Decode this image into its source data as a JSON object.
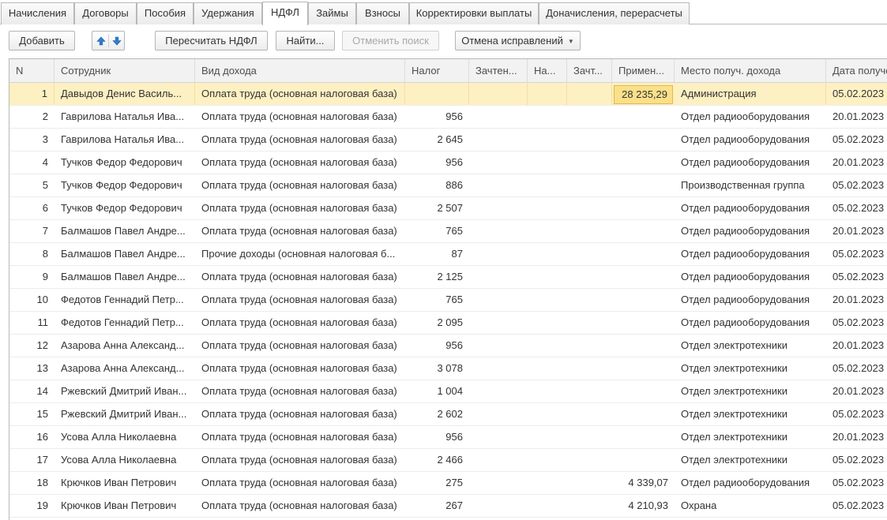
{
  "tabs": [
    {
      "label": "Начисления"
    },
    {
      "label": "Договоры"
    },
    {
      "label": "Пособия"
    },
    {
      "label": "Удержания"
    },
    {
      "label": "НДФЛ",
      "active": true
    },
    {
      "label": "Займы"
    },
    {
      "label": "Взносы"
    },
    {
      "label": "Корректировки выплаты"
    },
    {
      "label": "Доначисления, перерасчеты"
    }
  ],
  "toolbar": {
    "add_label": "Добавить",
    "move_up_icon": "arrow-up-icon",
    "move_down_icon": "arrow-down-icon",
    "recalc_label": "Пересчитать НДФЛ",
    "find_label": "Найти...",
    "cancel_search_label": "Отменить поиск",
    "undo_corrections_label": "Отмена исправлений"
  },
  "colors": {
    "selected_row": "#fdf0c2",
    "active_cell": "#fbe08a",
    "header_bg": "#f2f2f2",
    "arrow_blue": "#2f7fd0"
  },
  "grid": {
    "columns": [
      {
        "key": "n",
        "label": "N"
      },
      {
        "key": "employee",
        "label": "Сотрудник"
      },
      {
        "key": "income_type",
        "label": "Вид дохода"
      },
      {
        "key": "tax",
        "label": "Налог"
      },
      {
        "key": "credited1",
        "label": "Зачтен..."
      },
      {
        "key": "na",
        "label": "На..."
      },
      {
        "key": "credited2",
        "label": "Зачт..."
      },
      {
        "key": "applied",
        "label": "Примен..."
      },
      {
        "key": "place",
        "label": "Место получ. дохода"
      },
      {
        "key": "date",
        "label": "Дата получе"
      }
    ],
    "rows": [
      {
        "n": "1",
        "employee": "Давыдов Денис Василь...",
        "income_type": "Оплата труда (основная налоговая база)",
        "tax": "",
        "credited1": "",
        "na": "",
        "credited2": "",
        "applied": "28 235,29",
        "place": "Администрация",
        "date": "05.02.2023"
      },
      {
        "n": "2",
        "employee": "Гаврилова Наталья Ива...",
        "income_type": "Оплата труда (основная налоговая база)",
        "tax": "956",
        "credited1": "",
        "na": "",
        "credited2": "",
        "applied": "",
        "place": "Отдел радиооборудования",
        "date": "20.01.2023"
      },
      {
        "n": "3",
        "employee": "Гаврилова Наталья Ива...",
        "income_type": "Оплата труда (основная налоговая база)",
        "tax": "2 645",
        "credited1": "",
        "na": "",
        "credited2": "",
        "applied": "",
        "place": "Отдел радиооборудования",
        "date": "05.02.2023"
      },
      {
        "n": "4",
        "employee": "Тучков Федор Федорович",
        "income_type": "Оплата труда (основная налоговая база)",
        "tax": "956",
        "credited1": "",
        "na": "",
        "credited2": "",
        "applied": "",
        "place": "Отдел радиооборудования",
        "date": "20.01.2023"
      },
      {
        "n": "5",
        "employee": "Тучков Федор Федорович",
        "income_type": "Оплата труда (основная налоговая база)",
        "tax": "886",
        "credited1": "",
        "na": "",
        "credited2": "",
        "applied": "",
        "place": "Производственная группа",
        "date": "05.02.2023"
      },
      {
        "n": "6",
        "employee": "Тучков Федор Федорович",
        "income_type": "Оплата труда (основная налоговая база)",
        "tax": "2 507",
        "credited1": "",
        "na": "",
        "credited2": "",
        "applied": "",
        "place": "Отдел радиооборудования",
        "date": "05.02.2023"
      },
      {
        "n": "7",
        "employee": "Балмашов Павел Андре...",
        "income_type": "Оплата труда (основная налоговая база)",
        "tax": "765",
        "credited1": "",
        "na": "",
        "credited2": "",
        "applied": "",
        "place": "Отдел радиооборудования",
        "date": "20.01.2023"
      },
      {
        "n": "8",
        "employee": "Балмашов Павел Андре...",
        "income_type": "Прочие доходы (основная налоговая б...",
        "tax": "87",
        "credited1": "",
        "na": "",
        "credited2": "",
        "applied": "",
        "place": "Отдел радиооборудования",
        "date": "05.02.2023"
      },
      {
        "n": "9",
        "employee": "Балмашов Павел Андре...",
        "income_type": "Оплата труда (основная налоговая база)",
        "tax": "2 125",
        "credited1": "",
        "na": "",
        "credited2": "",
        "applied": "",
        "place": "Отдел радиооборудования",
        "date": "05.02.2023"
      },
      {
        "n": "10",
        "employee": "Федотов Геннадий Петр...",
        "income_type": "Оплата труда (основная налоговая база)",
        "tax": "765",
        "credited1": "",
        "na": "",
        "credited2": "",
        "applied": "",
        "place": "Отдел радиооборудования",
        "date": "20.01.2023"
      },
      {
        "n": "11",
        "employee": "Федотов Геннадий Петр...",
        "income_type": "Оплата труда (основная налоговая база)",
        "tax": "2 095",
        "credited1": "",
        "na": "",
        "credited2": "",
        "applied": "",
        "place": "Отдел радиооборудования",
        "date": "05.02.2023"
      },
      {
        "n": "12",
        "employee": "Азарова Анна Александ...",
        "income_type": "Оплата труда (основная налоговая база)",
        "tax": "956",
        "credited1": "",
        "na": "",
        "credited2": "",
        "applied": "",
        "place": "Отдел электротехники",
        "date": "20.01.2023"
      },
      {
        "n": "13",
        "employee": "Азарова Анна Александ...",
        "income_type": "Оплата труда (основная налоговая база)",
        "tax": "3 078",
        "credited1": "",
        "na": "",
        "credited2": "",
        "applied": "",
        "place": "Отдел электротехники",
        "date": "05.02.2023"
      },
      {
        "n": "14",
        "employee": "Ржевский Дмитрий Иван...",
        "income_type": "Оплата труда (основная налоговая база)",
        "tax": "1 004",
        "credited1": "",
        "na": "",
        "credited2": "",
        "applied": "",
        "place": "Отдел электротехники",
        "date": "20.01.2023"
      },
      {
        "n": "15",
        "employee": "Ржевский Дмитрий Иван...",
        "income_type": "Оплата труда (основная налоговая база)",
        "tax": "2 602",
        "credited1": "",
        "na": "",
        "credited2": "",
        "applied": "",
        "place": "Отдел электротехники",
        "date": "05.02.2023"
      },
      {
        "n": "16",
        "employee": "Усова Алла Николаевна",
        "income_type": "Оплата труда (основная налоговая база)",
        "tax": "956",
        "credited1": "",
        "na": "",
        "credited2": "",
        "applied": "",
        "place": "Отдел электротехники",
        "date": "20.01.2023"
      },
      {
        "n": "17",
        "employee": "Усова Алла Николаевна",
        "income_type": "Оплата труда (основная налоговая база)",
        "tax": "2 466",
        "credited1": "",
        "na": "",
        "credited2": "",
        "applied": "",
        "place": "Отдел электротехники",
        "date": "05.02.2023"
      },
      {
        "n": "18",
        "employee": "Крючков Иван Петрович",
        "income_type": "Оплата труда (основная налоговая база)",
        "tax": "275",
        "credited1": "",
        "na": "",
        "credited2": "",
        "applied": "4 339,07",
        "place": "Отдел радиооборудования",
        "date": "05.02.2023"
      },
      {
        "n": "19",
        "employee": "Крючков Иван Петрович",
        "income_type": "Оплата труда (основная налоговая база)",
        "tax": "267",
        "credited1": "",
        "na": "",
        "credited2": "",
        "applied": "4 210,93",
        "place": "Охрана",
        "date": "05.02.2023"
      }
    ]
  }
}
